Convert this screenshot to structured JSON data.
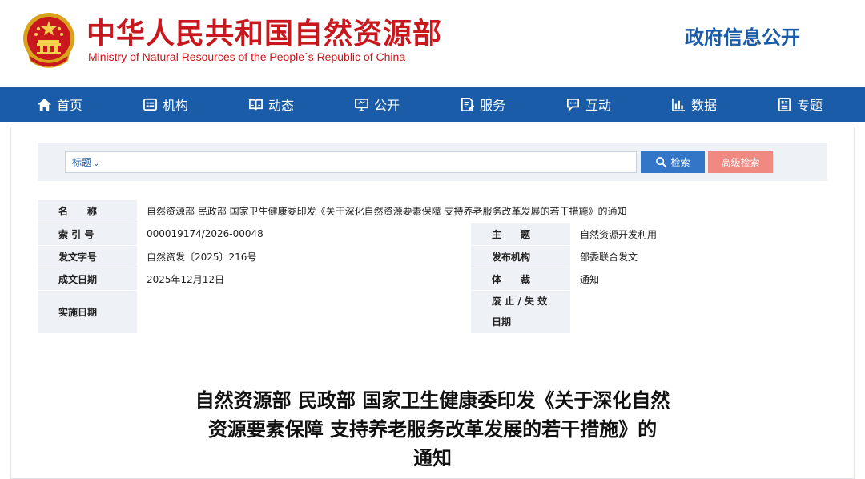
{
  "header": {
    "site_title_cn": "中华人民共和国自然资源部",
    "site_title_en": "Ministry of Natural Resources of the People´s Republic of China",
    "right_title": "政府信息公开"
  },
  "nav": {
    "items": [
      {
        "label": "首页",
        "icon": "home-icon"
      },
      {
        "label": "机构",
        "icon": "organization-icon"
      },
      {
        "label": "动态",
        "icon": "book-icon"
      },
      {
        "label": "公开",
        "icon": "monitor-icon"
      },
      {
        "label": "服务",
        "icon": "document-edit-icon"
      },
      {
        "label": "互动",
        "icon": "chat-icon"
      },
      {
        "label": "数据",
        "icon": "bar-chart-icon"
      },
      {
        "label": "专题",
        "icon": "topic-icon"
      }
    ]
  },
  "search": {
    "select_label": "标题",
    "value": "",
    "search_label": "检索",
    "advanced_label": "高级检索"
  },
  "meta": {
    "name_label": "名　　称",
    "name_value": "自然资源部 民政部 国家卫生健康委印发《关于深化自然资源要素保障 支持养老服务改革发展的若干措施》的通知",
    "index_label": "索 引 号",
    "index_value": "000019174/2026-00048",
    "topic_label": "主　　题",
    "topic_value": "自然资源开发利用",
    "docno_label": "发文字号",
    "docno_value": "自然资发〔2025〕216号",
    "publisher_label": "发布机构",
    "publisher_value": "部委联合发文",
    "date_label": "成文日期",
    "date_value": "2025年12月12日",
    "genre_label": "体　　裁",
    "genre_value": "通知",
    "impl_label": "实施日期",
    "impl_value": "",
    "expiry_label_1": "废 止 / 失 效",
    "expiry_label_2": "日期",
    "expiry_value": ""
  },
  "doc": {
    "title_line1": "自然资源部 民政部 国家卫生健康委印发《关于深化自然",
    "title_line2": "资源要素保障 支持养老服务改革发展的若干措施》的",
    "title_line3": "通知"
  },
  "colors": {
    "brand_red": "#c8171d",
    "brand_blue": "#1a5ca8",
    "search_blue": "#3376c8",
    "advanced_salmon": "#f08a80",
    "label_bg": "#eef1f5"
  }
}
